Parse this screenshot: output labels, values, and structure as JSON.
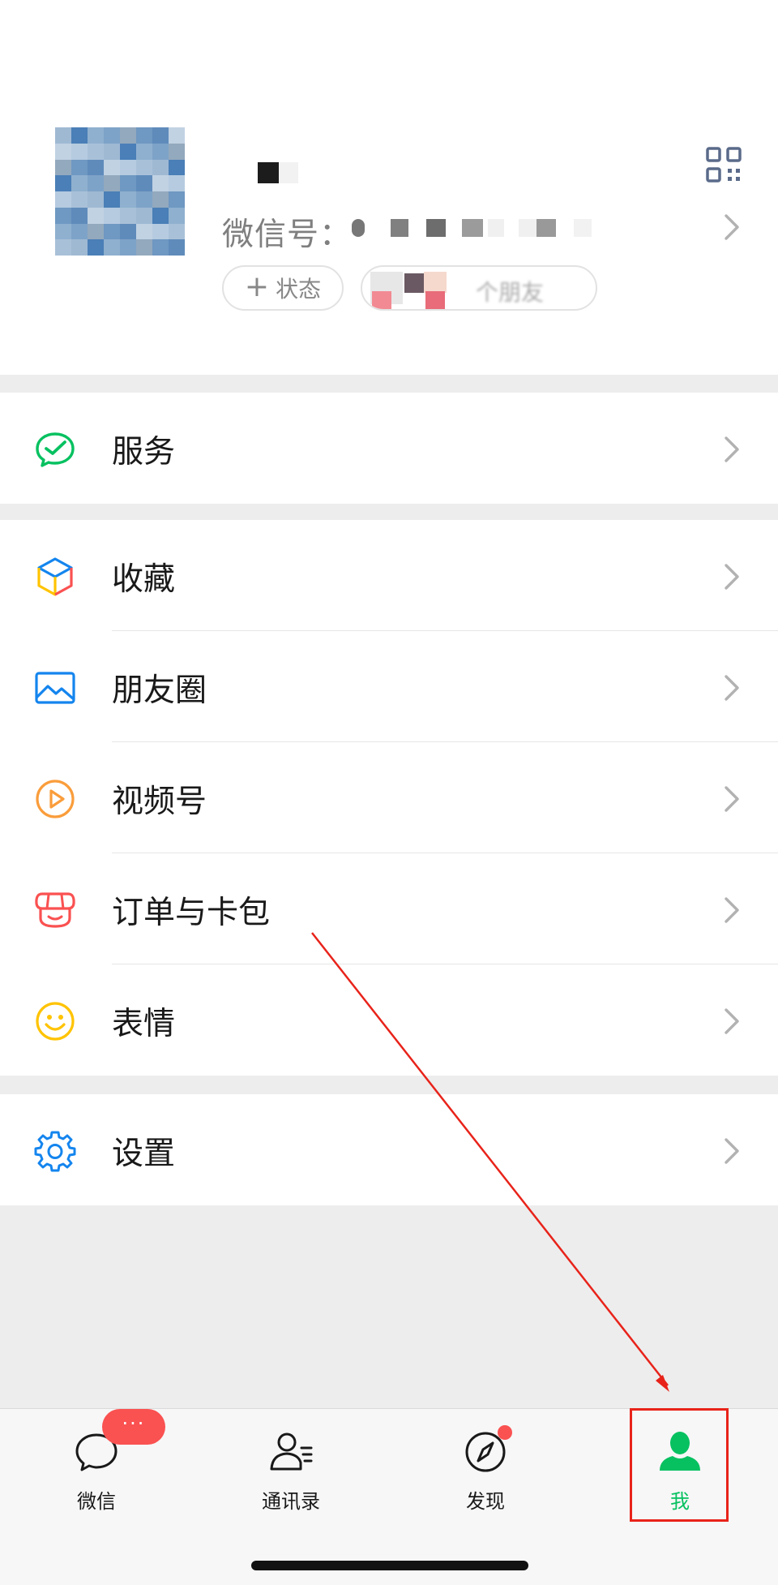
{
  "profile": {
    "wechat_id_label": "微信号：",
    "status_button_label": "状态",
    "status_plus": "+",
    "friends_button_label": "个朋友"
  },
  "menu": {
    "services": "服务",
    "favorites": "收藏",
    "moments": "朋友圈",
    "channels": "视频号",
    "orders_cards": "订单与卡包",
    "stickers": "表情",
    "settings": "设置"
  },
  "tabbar": {
    "chats": "微信",
    "contacts": "通讯录",
    "discover": "发现",
    "me": "我",
    "chats_badge": "···"
  },
  "colors": {
    "brand_green": "#07c160",
    "badge_red": "#fa5151",
    "annotation_red": "#e8231a",
    "link_blue": "#1485ee",
    "orange": "#fa9d3b",
    "yellow": "#ffc300"
  },
  "icons": {
    "services": "wechat-pay-icon",
    "favorites": "cube-icon",
    "moments": "picture-icon",
    "channels": "play-circle-icon",
    "orders_cards": "store-icon",
    "stickers": "smiley-icon",
    "settings": "gear-icon",
    "qr": "qr-code-icon",
    "chevron": "chevron-right-icon"
  }
}
